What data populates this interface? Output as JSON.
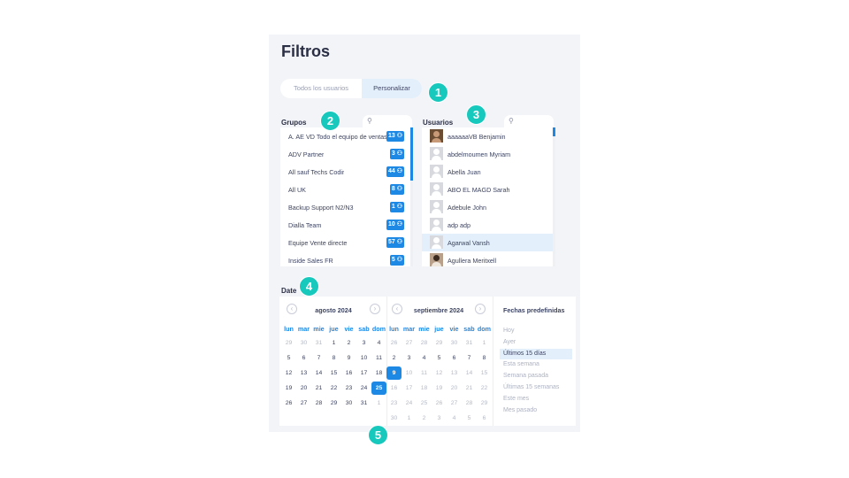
{
  "title": "Filtros",
  "toggle": {
    "options": [
      "Todos los usuarios",
      "Personalizar"
    ],
    "selected": "Personalizar"
  },
  "badges": [
    "1",
    "2",
    "3",
    "4",
    "5"
  ],
  "grupos": {
    "label": "Grupos",
    "items": [
      {
        "name": "A. AE VD Todo el equipo de ventas",
        "count": "13"
      },
      {
        "name": "ADV Partner",
        "count": "3"
      },
      {
        "name": "All sauf Techs Codir",
        "count": "44"
      },
      {
        "name": "All UK",
        "count": "8"
      },
      {
        "name": "Backup Support N2/N3",
        "count": "1"
      },
      {
        "name": "Dialla Team",
        "count": "10"
      },
      {
        "name": "Equipe Vente directe",
        "count": "57"
      },
      {
        "name": "Inside Sales FR",
        "count": "5"
      }
    ]
  },
  "usuarios": {
    "label": "Usuarios",
    "items": [
      {
        "name": "aaaaaaVB Benjamin",
        "avatar": "photo"
      },
      {
        "name": "abdelmoumen Myriam",
        "avatar": "placeholder-user-icon"
      },
      {
        "name": "Abella Juan",
        "avatar": "placeholder-user-icon"
      },
      {
        "name": "ABO EL MAGD Sarah",
        "avatar": "placeholder-user-icon"
      },
      {
        "name": "Adebule John",
        "avatar": "placeholder-user-icon"
      },
      {
        "name": "adp adp",
        "avatar": "placeholder-user-icon"
      },
      {
        "name": "Agarwal Vansh",
        "avatar": "placeholder-user-icon",
        "selected": true
      },
      {
        "name": "Agullera Meritxell",
        "avatar": "photo"
      }
    ]
  },
  "date": {
    "label": "Date",
    "weekdays": [
      "lun",
      "mar",
      "mie",
      "jue",
      "vie",
      "sab",
      "dom"
    ],
    "calendars": [
      {
        "month": "agosto 2024",
        "days": [
          [
            "29",
            "30",
            "31",
            "1",
            "2",
            "3",
            "4"
          ],
          [
            "5",
            "6",
            "7",
            "8",
            "9",
            "10",
            "11"
          ],
          [
            "12",
            "13",
            "14",
            "15",
            "16",
            "17",
            "18"
          ],
          [
            "19",
            "20",
            "21",
            "22",
            "23",
            "24",
            "25"
          ],
          [
            "26",
            "27",
            "28",
            "29",
            "30",
            "31",
            "1"
          ]
        ]
      },
      {
        "month": "septiembre 2024",
        "days": [
          [
            "26",
            "27",
            "28",
            "29",
            "30",
            "31",
            "1"
          ],
          [
            "2",
            "3",
            "4",
            "5",
            "6",
            "7",
            "8"
          ],
          [
            "9",
            "10",
            "11",
            "12",
            "13",
            "14",
            "15"
          ],
          [
            "16",
            "17",
            "18",
            "19",
            "20",
            "21",
            "22"
          ],
          [
            "23",
            "24",
            "25",
            "26",
            "27",
            "28",
            "29"
          ],
          [
            "30",
            "1",
            "2",
            "3",
            "4",
            "5",
            "6"
          ]
        ]
      }
    ],
    "presets_title": "Fechas predefinidas",
    "presets": [
      "Hoy",
      "Ayer",
      "Últimos 15 días",
      "Esta semana",
      "Semana pasada",
      "Últimas 15 semanas",
      "Este mes",
      "Mes pasado"
    ],
    "active_preset": "Últimos 15 días"
  },
  "colors": {
    "accent": "#1e88e5",
    "badge": "#17c8bd",
    "panel": "#f3f4f8"
  }
}
